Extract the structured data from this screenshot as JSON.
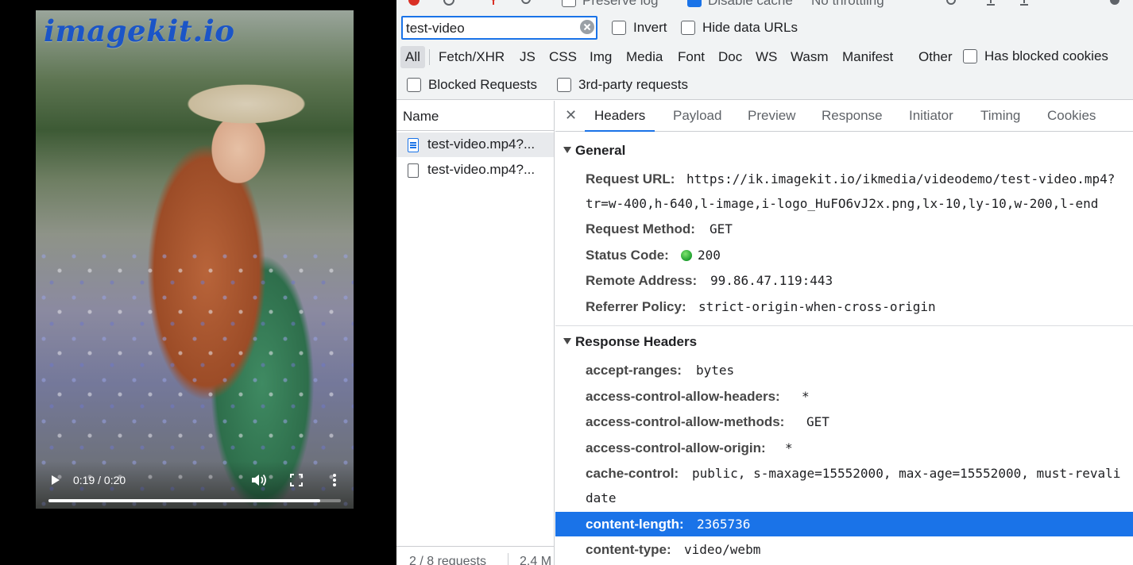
{
  "video": {
    "logo": "imagekit.io",
    "time": "0:19 / 0:20",
    "progress_fraction": 0.93
  },
  "toolbar_top": {
    "preserve_log": "Preserve log",
    "disable_cache": "Disable cache",
    "throttling": "No throttling"
  },
  "filter": {
    "value": "test-video",
    "invert": "Invert",
    "hide_data_urls": "Hide data URLs",
    "types": [
      "All",
      "Fetch/XHR",
      "JS",
      "CSS",
      "Img",
      "Media",
      "Font",
      "Doc",
      "WS",
      "Wasm",
      "Manifest",
      "Other"
    ],
    "active_type": "All",
    "has_blocked_cookies": "Has blocked cookies",
    "blocked_requests": "Blocked Requests",
    "third_party": "3rd-party requests"
  },
  "requests": {
    "column": "Name",
    "items": [
      {
        "name": "test-video.mp4?...",
        "selected": true
      },
      {
        "name": "test-video.mp4?...",
        "selected": false
      }
    ],
    "summary": "2 / 8 requests",
    "transferred": "2.4 M"
  },
  "tabs": [
    "Headers",
    "Payload",
    "Preview",
    "Response",
    "Initiator",
    "Timing",
    "Cookies"
  ],
  "active_tab": "Headers",
  "general": {
    "title": "General",
    "request_url_label": "Request URL:",
    "request_url_1": "https://ik.imagekit.io/ikmedia/videodemo/test-video.mp4?",
    "request_url_2": "tr=w-400,h-640,l-image,i-logo_HuFO6vJ2x.png,lx-10,ly-10,w-200,l-end",
    "method_label": "Request Method:",
    "method": "GET",
    "status_label": "Status Code:",
    "status": "200",
    "status_color": "#1e9f2e",
    "remote_label": "Remote Address:",
    "remote": "99.86.47.119:443",
    "referrer_label": "Referrer Policy:",
    "referrer": "strict-origin-when-cross-origin"
  },
  "response_headers": {
    "title": "Response Headers",
    "accept_ranges_label": "accept-ranges:",
    "accept_ranges": "bytes",
    "acah_label": "access-control-allow-headers:",
    "acah": "*",
    "acam_label": "access-control-allow-methods:",
    "acam": "GET",
    "acao_label": "access-control-allow-origin:",
    "acao": "*",
    "cache_control_label": "cache-control:",
    "cache_control_1": "public, s-maxage=15552000, max-age=15552000, must-revali",
    "cache_control_2": "date",
    "content_length_label": "content-length:",
    "content_length": "2365736",
    "content_type_label": "content-type:",
    "content_type": "video/webm"
  },
  "colors": {
    "accent": "#1a73e8",
    "logo": "#1b55c7"
  }
}
